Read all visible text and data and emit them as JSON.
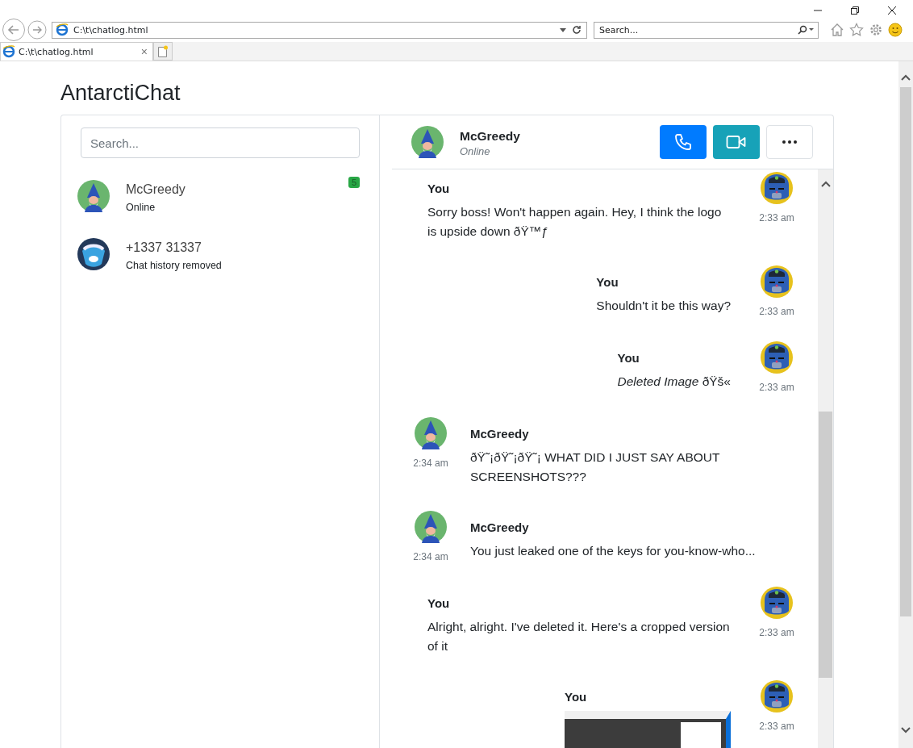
{
  "browser": {
    "address": "C:\\t\\chatlog.html",
    "search_placeholder": "Search...",
    "tab": {
      "title": "C:\\t\\chatlog.html",
      "close": "×"
    }
  },
  "app": {
    "title": "AntarctiChat"
  },
  "sidebar": {
    "search": {
      "placeholder": "Search..."
    },
    "contacts": [
      {
        "name": "McGreedy",
        "status": "Online",
        "unread": "5"
      },
      {
        "name": "+1337 31337",
        "status": "Chat history removed"
      }
    ]
  },
  "chat": {
    "contact": {
      "name": "McGreedy",
      "status": "Online"
    },
    "messages": [
      {
        "kind": "outgoing",
        "image": false,
        "sender": "You",
        "text": "Sorry boss! Won't happen again. Hey, I think the logo is upside down ðŸ™ƒ",
        "time": "2:33 am"
      },
      {
        "kind": "outgoing",
        "image": false,
        "sender": "You",
        "text": "Shouldn't it be this way?",
        "time": "2:33 am"
      },
      {
        "kind": "outgoing",
        "image": false,
        "sender": "You",
        "text": "*Deleted Image* ðŸš«",
        "time": "2:33 am"
      },
      {
        "kind": "incoming",
        "image": false,
        "sender": "McGreedy",
        "text": "ðŸ˜¡ðŸ˜¡ðŸ˜¡ WHAT DID I JUST SAY ABOUT SCREENSHOTS???",
        "time": "2:34 am"
      },
      {
        "kind": "incoming",
        "image": false,
        "sender": "McGreedy",
        "text": "You just leaked one of the keys for you-know-who...",
        "time": "2:34 am"
      },
      {
        "kind": "outgoing",
        "image": false,
        "sender": "You",
        "text": "Alright, alright. I've deleted it. Here's a cropped version of it",
        "time": "2:33 am"
      },
      {
        "kind": "outgoing",
        "image": true,
        "sender": "You",
        "time": "2:33 am"
      }
    ]
  }
}
